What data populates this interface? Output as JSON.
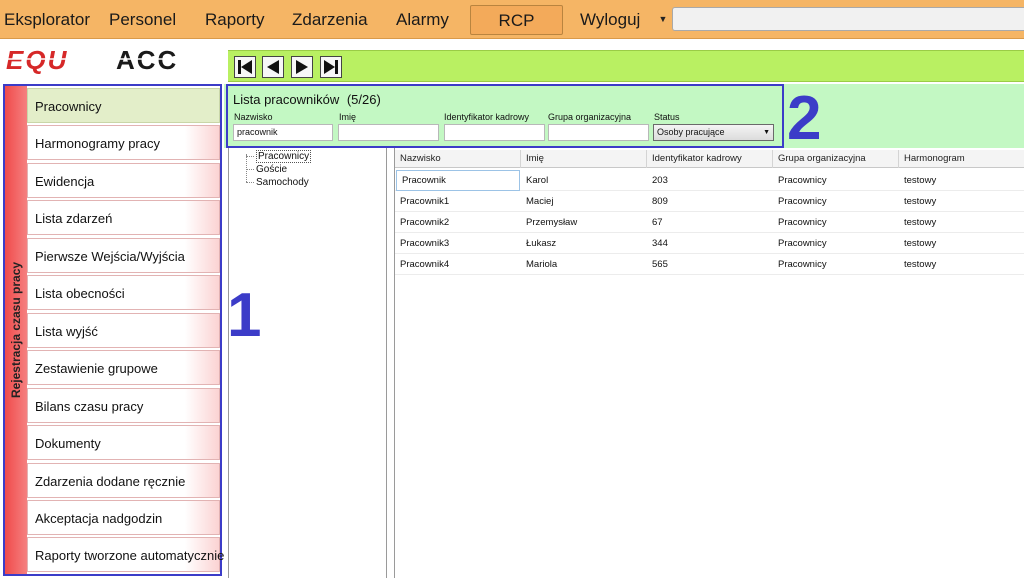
{
  "menu": {
    "items": [
      "Eksplorator",
      "Personel",
      "Raporty",
      "Zdarzenia",
      "Alarmy",
      "RCP",
      "Wyloguj"
    ],
    "active": "RCP",
    "dropdown_icon": "caret-down-icon",
    "search_value": ""
  },
  "logo": {
    "part1": "EQU",
    "part2": "ACC",
    "color1": "#d62828",
    "color2": "#1a1a1a"
  },
  "nav": {
    "buttons": [
      "first-icon",
      "prev-icon",
      "next-icon",
      "last-icon"
    ]
  },
  "sidebar": {
    "section_label": "Rejestracja czasu pracy",
    "items": [
      "Pracownicy",
      "Harmonogramy pracy",
      "Ewidencja",
      "Lista zdarzeń",
      "Pierwsze Wejścia/Wyjścia",
      "Lista obecności",
      "Lista wyjść",
      "Zestawienie grupowe",
      "Bilans czasu pracy",
      "Dokumenty",
      "Zdarzenia dodane ręcznie",
      "Akceptacja nadgodzin",
      "Raporty tworzone automatycznie"
    ],
    "active_index": 0
  },
  "annotations": {
    "one": "1",
    "two": "2",
    "color": "#3c3cc8"
  },
  "tree": {
    "items": [
      "Pracownicy",
      "Goście",
      "Samochody"
    ],
    "selected_index": 0
  },
  "filter": {
    "title": "Lista pracowników",
    "count": "(5/26)",
    "fields": [
      {
        "label": "Nazwisko",
        "value": "pracownik"
      },
      {
        "label": "Imię",
        "value": ""
      },
      {
        "label": "Identyfikator kadrowy",
        "value": ""
      },
      {
        "label": "Grupa organizacyjna",
        "value": ""
      }
    ],
    "status_label": "Status",
    "status_value": "Osoby pracujące"
  },
  "table": {
    "columns": [
      "Nazwisko",
      "Imię",
      "Identyfikator kadrowy",
      "Grupa organizacyjna",
      "Harmonogram"
    ],
    "rows": [
      [
        "Pracownik",
        "Karol",
        "203",
        "Pracownicy",
        "testowy"
      ],
      [
        "Pracownik1",
        "Maciej",
        "809",
        "Pracownicy",
        "testowy"
      ],
      [
        "Pracownik2",
        "Przemysław",
        "67",
        "Pracownicy",
        "testowy"
      ],
      [
        "Pracownik3",
        "Łukasz",
        "344",
        "Pracownicy",
        "testowy"
      ],
      [
        "Pracownik4",
        "Mariola",
        "565",
        "Pracownicy",
        "testowy"
      ]
    ]
  },
  "colors": {
    "menu_bg": "#f5b565",
    "nav_green": "#b9f062",
    "filter_bg": "#c3f8c3",
    "sidebar_band": "#f04b4b",
    "highlight_border": "#3c3cc8"
  }
}
